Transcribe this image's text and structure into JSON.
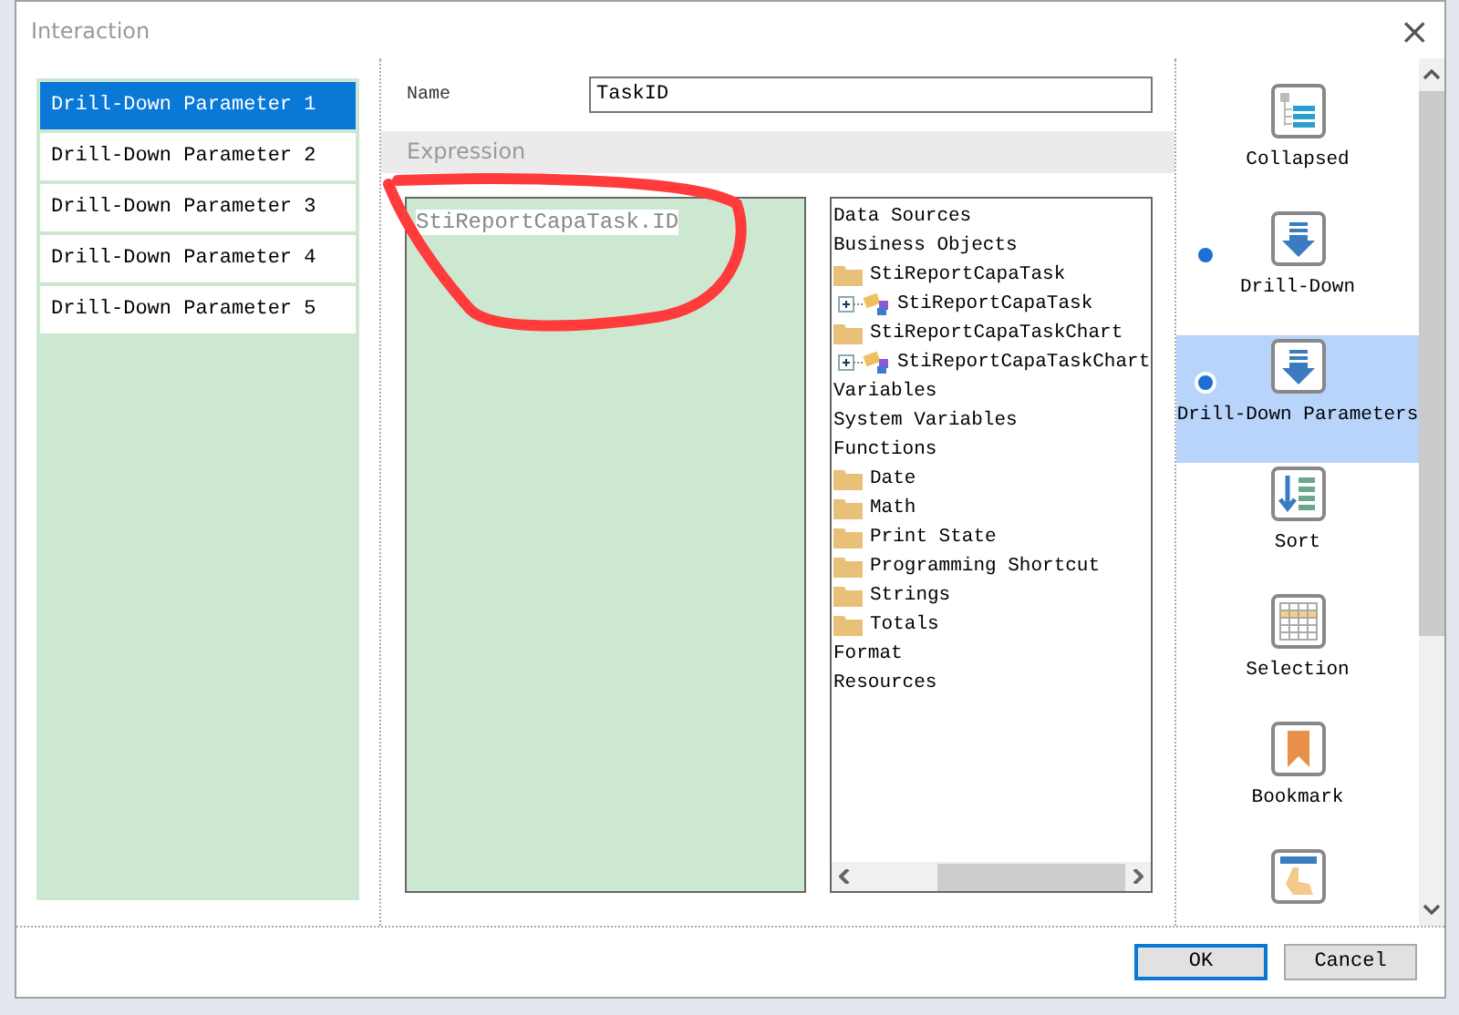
{
  "window": {
    "title": "Interaction",
    "close": "×"
  },
  "parameters": [
    {
      "label": "Drill-Down Parameter 1",
      "selected": true
    },
    {
      "label": "Drill-Down Parameter 2",
      "selected": false
    },
    {
      "label": "Drill-Down Parameter 3",
      "selected": false
    },
    {
      "label": "Drill-Down Parameter 4",
      "selected": false
    },
    {
      "label": "Drill-Down Parameter 5",
      "selected": false
    }
  ],
  "name_field": {
    "label": "Name",
    "value": "TaskID"
  },
  "expression": {
    "header": "Expression",
    "value": "StiReportCapaTask.ID"
  },
  "tree": [
    {
      "label": "Data Sources"
    },
    {
      "label": "Business Objects",
      "children": [
        {
          "label": "StiReportCapaTask",
          "kind": "folder",
          "children": [
            {
              "label": "StiReportCapaTask",
              "kind": "object"
            }
          ]
        },
        {
          "label": "StiReportCapaTaskChart",
          "kind": "folder",
          "children": [
            {
              "label": "StiReportCapaTaskChart",
              "kind": "object"
            }
          ]
        }
      ]
    },
    {
      "label": "Variables"
    },
    {
      "label": "System Variables"
    },
    {
      "label": "Functions",
      "children": [
        {
          "label": "Date",
          "kind": "folder"
        },
        {
          "label": "Math",
          "kind": "folder"
        },
        {
          "label": "Print State",
          "kind": "folder"
        },
        {
          "label": "Programming Shortcut",
          "kind": "folder"
        },
        {
          "label": "Strings",
          "kind": "folder"
        },
        {
          "label": "Totals",
          "kind": "folder"
        }
      ]
    },
    {
      "label": "Format"
    },
    {
      "label": "Resources"
    }
  ],
  "actions": [
    {
      "label": "Collapsed",
      "kind": "collapsed",
      "enabled": false,
      "selected": false
    },
    {
      "label": "Drill-Down",
      "kind": "drilldown",
      "enabled": true,
      "selected": false
    },
    {
      "label": "Drill-Down Parameters",
      "kind": "drilldown",
      "enabled": true,
      "selected": true
    },
    {
      "label": "Sort",
      "kind": "sort",
      "enabled": false,
      "selected": false
    },
    {
      "label": "Selection",
      "kind": "selection",
      "enabled": false,
      "selected": false
    },
    {
      "label": "Bookmark",
      "kind": "bookmark",
      "enabled": false,
      "selected": false
    },
    {
      "kind": "hyperlink",
      "enabled": false,
      "selected": false
    }
  ],
  "buttons": [
    {
      "label": "OK",
      "default": true
    },
    {
      "label": "Cancel",
      "default": false
    }
  ]
}
